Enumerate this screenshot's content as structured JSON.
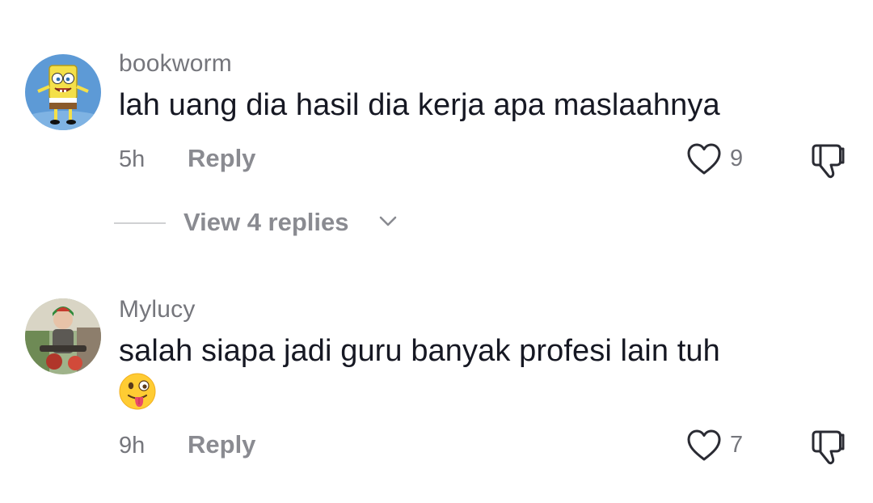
{
  "comments": [
    {
      "username": "bookworm",
      "text": "lah uang dia hasil dia kerja apa maslaahnya",
      "time": "5h",
      "reply_label": "Reply",
      "likes": "9",
      "view_replies": "View 4 replies",
      "avatar_icon": "spongebob-avatar"
    },
    {
      "username": "Mylucy",
      "text": "salah siapa jadi guru banyak profesi lain tuh",
      "emoji": "winking-face-with-tongue",
      "time": "9h",
      "reply_label": "Reply",
      "likes": "7",
      "avatar_icon": "photo-avatar"
    }
  ],
  "colors": {
    "primary_text": "#161823",
    "secondary_text": "#75767c",
    "action_text": "#8a8b91",
    "divider": "#d0d1d3"
  }
}
